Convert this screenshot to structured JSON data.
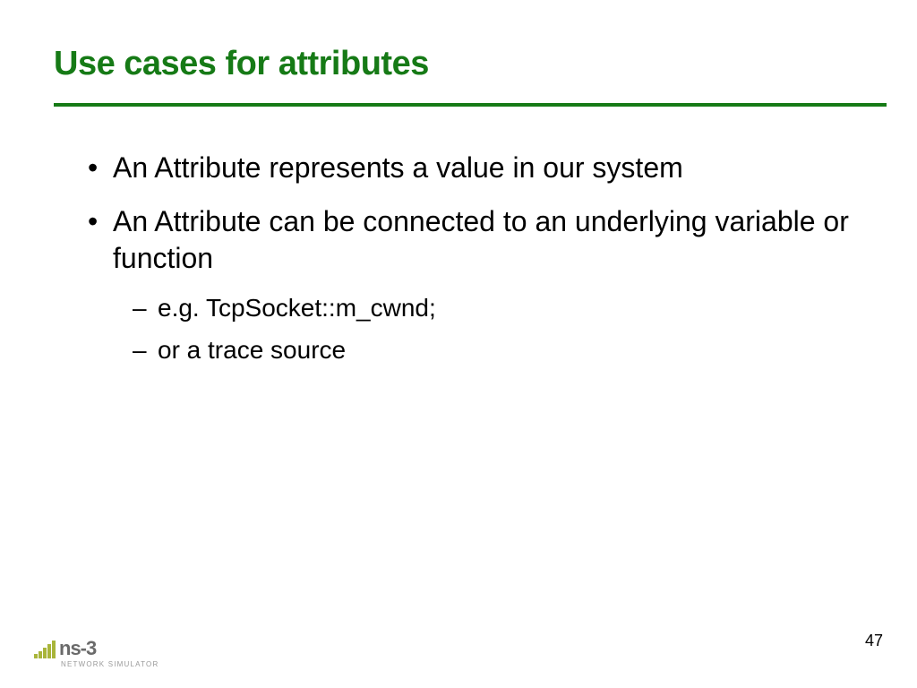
{
  "title": "Use cases for attributes",
  "bullets": [
    {
      "text": "An Attribute represents a value in our system"
    },
    {
      "text": "An Attribute can be connected to an underlying variable or function",
      "sub": [
        "e.g. TcpSocket::m_cwnd;",
        "or a trace source"
      ]
    }
  ],
  "logo": {
    "name": "ns-3",
    "sub": "NETWORK SIMULATOR"
  },
  "page": "47",
  "colors": {
    "accent": "#167a16",
    "logo_bar": "#a9b53a"
  }
}
